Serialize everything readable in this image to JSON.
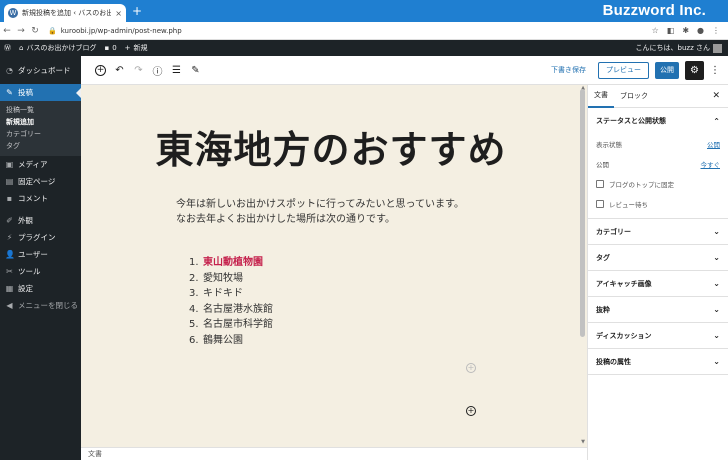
{
  "browser": {
    "tab_title": "新規投稿を追加 ‹ バスのお出かけブ",
    "tab_close": "×",
    "new_tab": "+",
    "url": "kuroobi.jp/wp-admin/post-new.php",
    "brand": "Buzzword Inc."
  },
  "adminbar": {
    "site_name": "バスのお出かけブログ",
    "comments_count": "0",
    "new_label": "新規",
    "greeting": "こんにちは、buzz さん"
  },
  "sidebar": {
    "dashboard": "ダッシュボード",
    "posts": "投稿",
    "posts_sub": [
      "投稿一覧",
      "新規追加",
      "カテゴリー",
      "タグ"
    ],
    "media": "メディア",
    "pages": "固定ページ",
    "comments": "コメント",
    "appearance": "外観",
    "plugins": "プラグイン",
    "users": "ユーザー",
    "tools": "ツール",
    "settings": "設定",
    "collapse": "メニューを閉じる"
  },
  "toolbar": {
    "save_draft": "下書き保存",
    "preview": "プレビュー",
    "publish": "公開"
  },
  "content": {
    "title": "東海地方のおすすめ",
    "paragraph_line1": "今年は新しいお出かけスポットに行ってみたいと思っています。",
    "paragraph_line2": "なお去年よくお出かけした場所は次の通りです。",
    "list": [
      {
        "num": "1.",
        "text": "東山動植物園"
      },
      {
        "num": "2.",
        "text": "愛知牧場"
      },
      {
        "num": "3.",
        "text": "キドキド"
      },
      {
        "num": "4.",
        "text": "名古屋港水族館"
      },
      {
        "num": "5.",
        "text": "名古屋市科学館"
      },
      {
        "num": "6.",
        "text": "鶴舞公園"
      }
    ]
  },
  "statusbar": {
    "breadcrumb": "文書"
  },
  "settings": {
    "tab_document": "文書",
    "tab_block": "ブロック",
    "status_panel": "ステータスと公開状態",
    "visibility_label": "表示状態",
    "visibility_value": "公開",
    "publish_label": "公開",
    "publish_value": "今すぐ",
    "stick_label": "ブログのトップに固定",
    "review_label": "レビュー待ち",
    "panels": [
      "カテゴリー",
      "タグ",
      "アイキャッチ画像",
      "抜粋",
      "ディスカッション",
      "投稿の属性"
    ]
  },
  "colors": {
    "browser_blue": "#1f7fd1",
    "wp_dark": "#1d2327",
    "wp_blue": "#2271b1",
    "canvas_bg": "#f4efe2",
    "link_red": "#c5224d"
  }
}
